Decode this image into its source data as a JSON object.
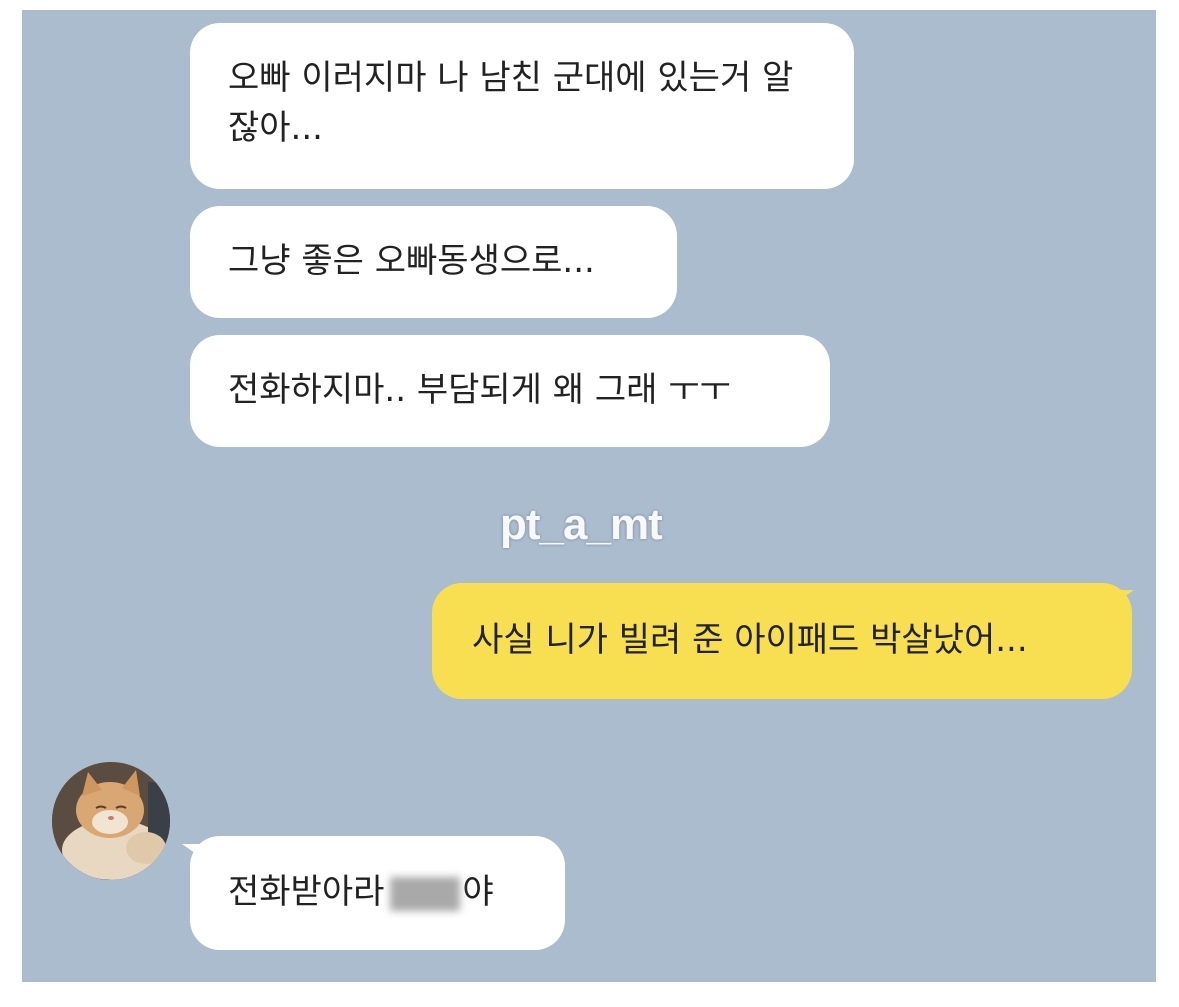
{
  "chat": {
    "background_color": "#abbccf",
    "incoming_bubble_color": "#ffffff",
    "outgoing_bubble_color": "#f8df52",
    "messages": [
      {
        "direction": "in",
        "text": "오빠 이러지마 나 남친 군대에 있는거 알잖아..."
      },
      {
        "direction": "in",
        "text": "그냥 좋은 오빠동생으로..."
      },
      {
        "direction": "in",
        "text": "전화하지마.. 부담되게 왜 그래 ㅜㅜ"
      },
      {
        "direction": "out",
        "text": "사실 니가 빌려 준 아이패드 박살났어..."
      },
      {
        "direction": "in",
        "text_before": "전화받아라",
        "text_after": "야",
        "has_blurred_name": true
      }
    ]
  },
  "watermark": {
    "text": "pt_a_mt"
  },
  "avatar": {
    "icon": "cat-photo-avatar"
  }
}
